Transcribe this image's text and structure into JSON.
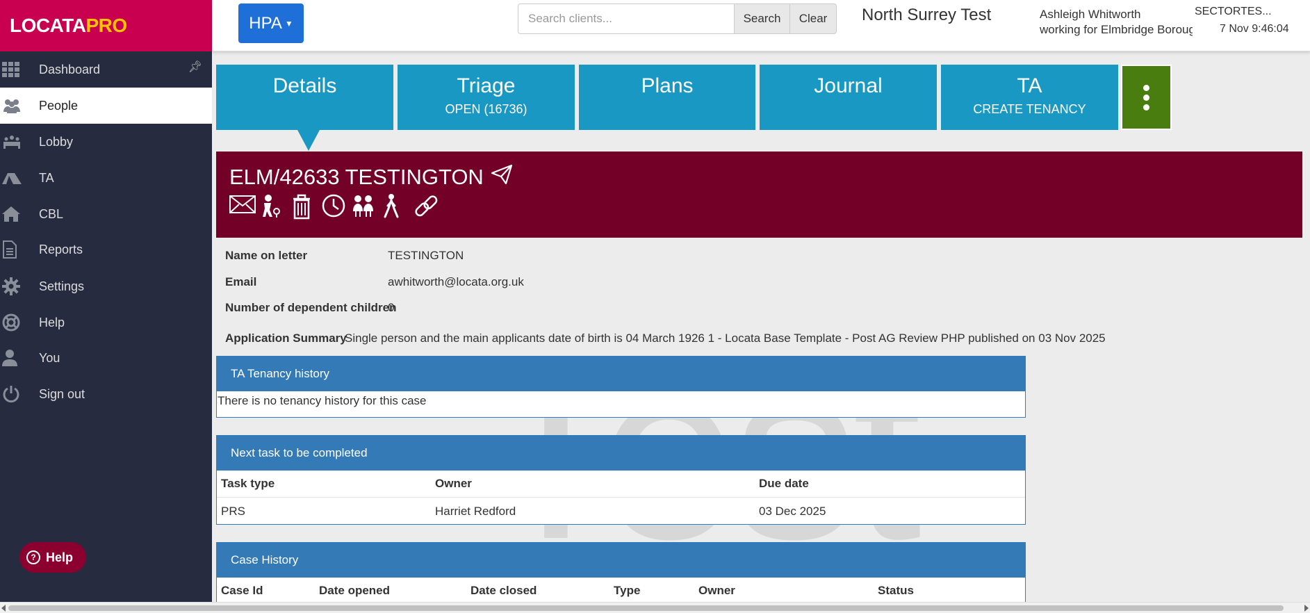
{
  "sidebar": {
    "logo": {
      "part1": "LOCATA",
      "part2": "PRO"
    },
    "items": [
      {
        "label": "Dashboard",
        "icon": "grid-icon"
      },
      {
        "label": "People",
        "icon": "people-icon"
      },
      {
        "label": "Lobby",
        "icon": "lobby-icon"
      },
      {
        "label": "TA",
        "icon": "tent-icon"
      },
      {
        "label": "CBL",
        "icon": "home-icon"
      },
      {
        "label": "Reports",
        "icon": "document-icon"
      },
      {
        "label": "Settings",
        "icon": "gear-icon"
      },
      {
        "label": "Help",
        "icon": "lifebuoy-icon"
      },
      {
        "label": "You",
        "icon": "user-icon"
      },
      {
        "label": "Sign out",
        "icon": "power-icon"
      }
    ],
    "help_button": "Help"
  },
  "topbar": {
    "module_button": "HPA",
    "search_placeholder": "Search clients...",
    "search_label": "Search",
    "clear_label": "Clear",
    "org_name": "North Surrey Test",
    "user_name": "Ashleigh Whitworth",
    "user_org": "working for Elmbridge Boroug...",
    "environment": "SECTORTES...",
    "datetime": "7 Nov 9:46:04"
  },
  "tabs": {
    "details": {
      "title": "Details"
    },
    "triage": {
      "title": "Triage",
      "subtitle": "OPEN (16736)"
    },
    "plans": {
      "title": "Plans"
    },
    "journal": {
      "title": "Journal"
    },
    "ta": {
      "title": "TA",
      "subtitle": "CREATE TENANCY"
    }
  },
  "client": {
    "reference": "ELM/42633 TESTINGTON",
    "icons": [
      "envelope-icon",
      "caseworker-icon",
      "trash-icon",
      "history-icon",
      "household-icon",
      "walking-icon",
      "link-icon"
    ]
  },
  "details": {
    "name_on_letter_label": "Name on letter",
    "name_on_letter": "TESTINGTON",
    "email_label": "Email",
    "email": "awhitworth@locata.org.uk",
    "children_label": "Number of dependent children",
    "children": "0",
    "summary_label": "Application Summary",
    "summary": "Single person and the main applicants date of birth is 04 March 1926 1 - Locata Base Template - Post AG Review PHP published on 03 Nov 2025"
  },
  "ta_history": {
    "title": "TA Tenancy history",
    "empty_text": "There is no tenancy history for this case"
  },
  "next_task": {
    "title": "Next task to be completed",
    "columns": [
      "Task type",
      "Owner",
      "Due date"
    ],
    "rows": [
      [
        "PRS",
        "Harriet Redford",
        "03 Dec 2025"
      ]
    ]
  },
  "case_history": {
    "title": "Case History",
    "columns": [
      "Case Id",
      "Date opened",
      "Date closed",
      "Type",
      "Owner",
      "Status"
    ]
  },
  "watermark": "Test"
}
